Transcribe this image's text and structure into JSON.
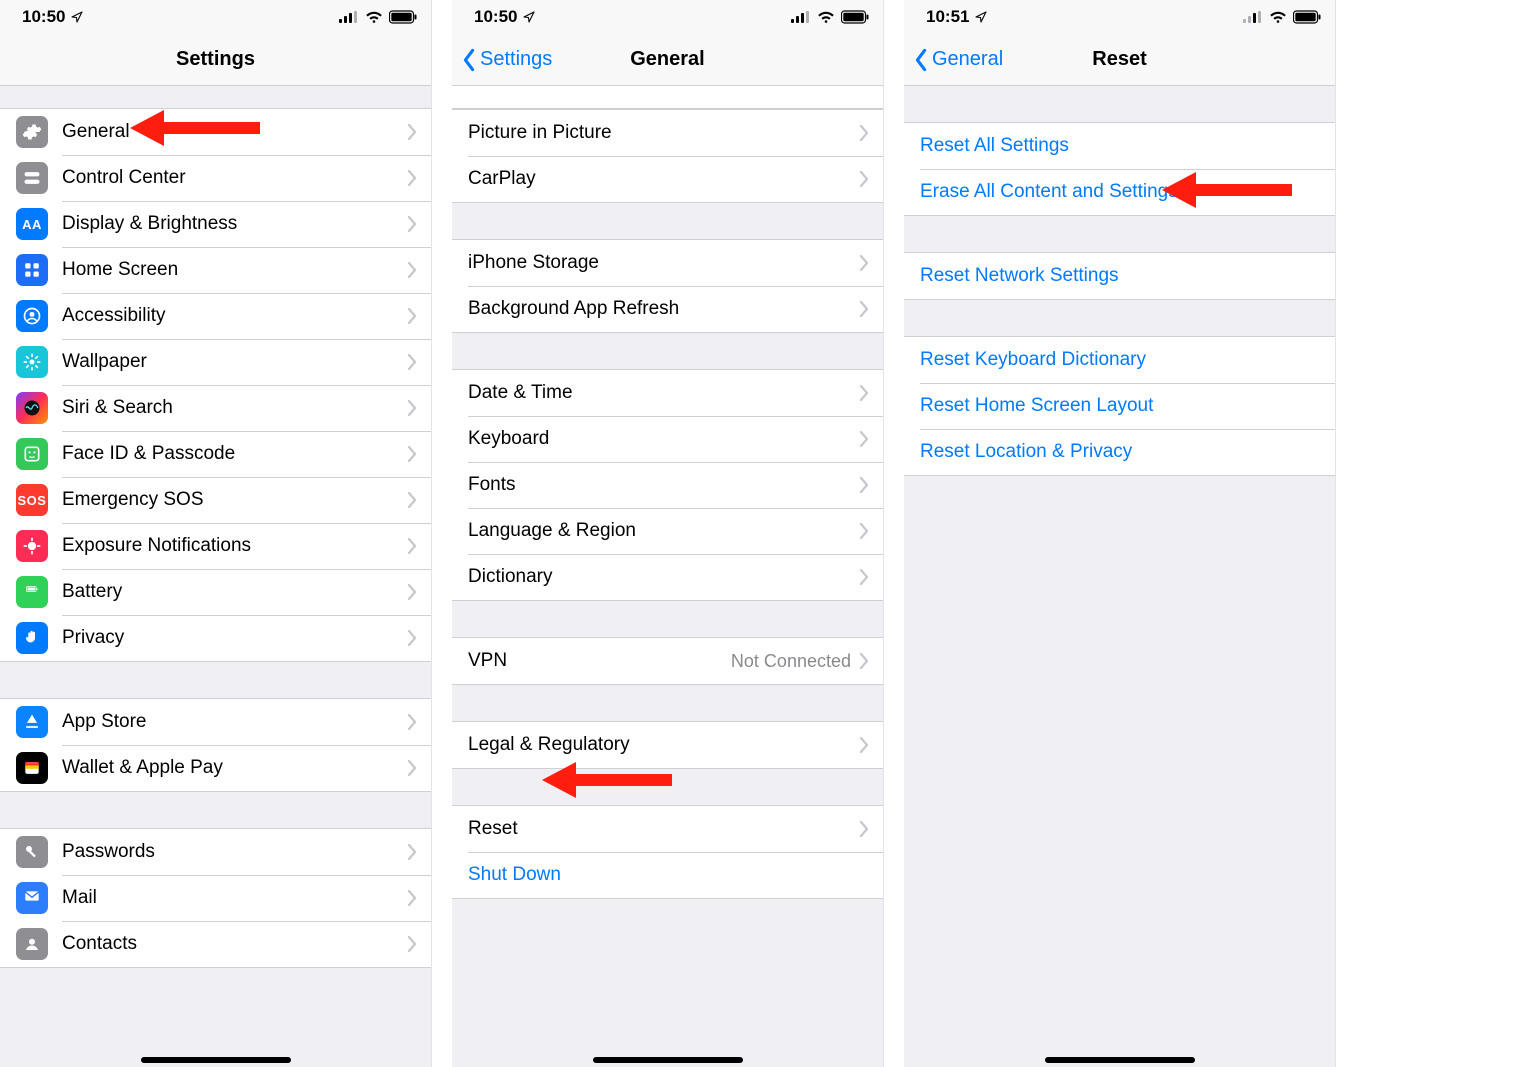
{
  "status": {
    "time_a": "10:50",
    "time_b": "10:50",
    "time_c": "10:51"
  },
  "panel1": {
    "title": "Settings",
    "rows_a": [
      {
        "id": "general",
        "label": "General",
        "icon": "gear",
        "iconClass": "ic-grey"
      },
      {
        "id": "control-center",
        "label": "Control Center",
        "icon": "toggles",
        "iconClass": "ic-grey"
      },
      {
        "id": "display-brightness",
        "label": "Display & Brightness",
        "icon": "AA",
        "iconClass": "ic-blue"
      },
      {
        "id": "home-screen",
        "label": "Home Screen",
        "icon": "grid",
        "iconClass": "ic-blue4"
      },
      {
        "id": "accessibility",
        "label": "Accessibility",
        "icon": "person",
        "iconClass": "ic-blue"
      },
      {
        "id": "wallpaper",
        "label": "Wallpaper",
        "icon": "flower",
        "iconClass": "ic-teal"
      },
      {
        "id": "siri-search",
        "label": "Siri & Search",
        "icon": "siri",
        "iconClass": "ic-purple"
      },
      {
        "id": "faceid-passcode",
        "label": "Face ID & Passcode",
        "icon": "face",
        "iconClass": "ic-green"
      },
      {
        "id": "emergency-sos",
        "label": "Emergency SOS",
        "icon": "SOS",
        "iconClass": "ic-red"
      },
      {
        "id": "exposure",
        "label": "Exposure Notifications",
        "icon": "virus",
        "iconClass": "ic-pink"
      },
      {
        "id": "battery",
        "label": "Battery",
        "icon": "battery",
        "iconClass": "ic-green2"
      },
      {
        "id": "privacy",
        "label": "Privacy",
        "icon": "hand",
        "iconClass": "ic-blue"
      }
    ],
    "rows_b": [
      {
        "id": "app-store",
        "label": "App Store",
        "icon": "appstore",
        "iconClass": "ic-blue2"
      },
      {
        "id": "wallet-applepay",
        "label": "Wallet & Apple Pay",
        "icon": "wallet",
        "iconClass": "ic-black"
      }
    ],
    "rows_c": [
      {
        "id": "passwords",
        "label": "Passwords",
        "icon": "key",
        "iconClass": "ic-grey"
      },
      {
        "id": "mail",
        "label": "Mail",
        "icon": "mail",
        "iconClass": "ic-blue3"
      },
      {
        "id": "contacts",
        "label": "Contacts",
        "icon": "contacts",
        "iconClass": "ic-grey"
      }
    ]
  },
  "panel2": {
    "back": "Settings",
    "title": "General",
    "rows_a": [
      {
        "id": "pip",
        "label": "Picture in Picture"
      },
      {
        "id": "carplay",
        "label": "CarPlay"
      }
    ],
    "rows_b": [
      {
        "id": "storage",
        "label": "iPhone Storage"
      },
      {
        "id": "bgapp",
        "label": "Background App Refresh"
      }
    ],
    "rows_c": [
      {
        "id": "datetime",
        "label": "Date & Time"
      },
      {
        "id": "keyboard",
        "label": "Keyboard"
      },
      {
        "id": "fonts",
        "label": "Fonts"
      },
      {
        "id": "langreg",
        "label": "Language & Region"
      },
      {
        "id": "dict",
        "label": "Dictionary"
      }
    ],
    "rows_d": [
      {
        "id": "vpn",
        "label": "VPN",
        "value": "Not Connected"
      }
    ],
    "rows_e": [
      {
        "id": "legal",
        "label": "Legal & Regulatory"
      }
    ],
    "rows_f": [
      {
        "id": "reset",
        "label": "Reset"
      },
      {
        "id": "shutdown",
        "label": "Shut Down",
        "link": true,
        "nochev": true
      }
    ]
  },
  "panel3": {
    "back": "General",
    "title": "Reset",
    "rows_a": [
      {
        "id": "reset-all",
        "label": "Reset All Settings"
      },
      {
        "id": "erase-all",
        "label": "Erase All Content and Settings"
      }
    ],
    "rows_b": [
      {
        "id": "reset-net",
        "label": "Reset Network Settings"
      }
    ],
    "rows_c": [
      {
        "id": "reset-kbd",
        "label": "Reset Keyboard Dictionary"
      },
      {
        "id": "reset-home",
        "label": "Reset Home Screen Layout"
      },
      {
        "id": "reset-loc",
        "label": "Reset Location & Privacy"
      }
    ]
  }
}
